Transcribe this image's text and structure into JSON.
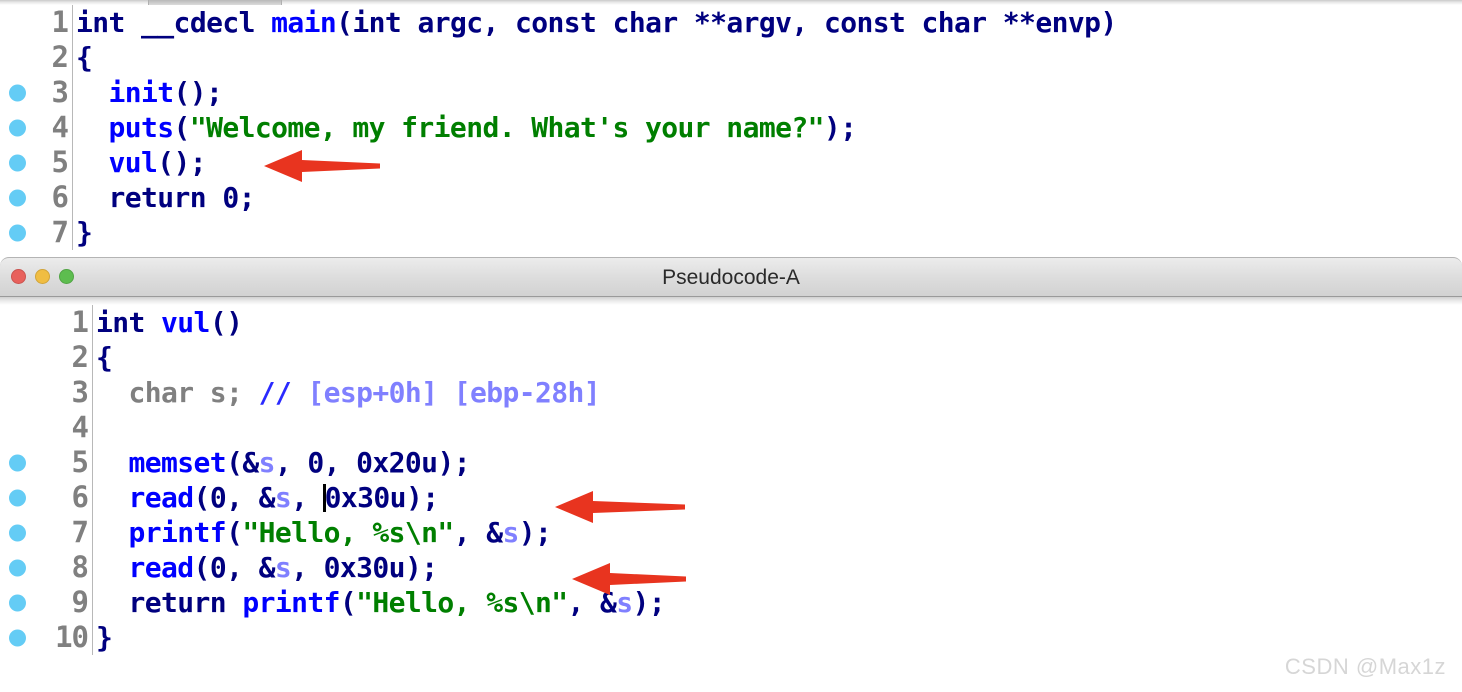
{
  "app": {
    "watermark": "CSDN @Max1z"
  },
  "colors": {
    "keyword": "#00007f",
    "function": "#0000ff",
    "string": "#007f00",
    "local_var": "#8080ff",
    "comment": "#8080ff",
    "declaration_type": "#808080",
    "breakpoint_dot": "#64ccf5",
    "line_number": "#808080",
    "arrow": "#e8341f",
    "traffic_red": "#e8615c",
    "traffic_yellow": "#f0bd42",
    "traffic_green": "#5dbd4f"
  },
  "pane_main": {
    "title": "",
    "lines": [
      {
        "num": "1",
        "breakpoint": false,
        "text": "int __cdecl main(int argc, const char **argv, const char **envp)"
      },
      {
        "num": "2",
        "breakpoint": false,
        "text": "{"
      },
      {
        "num": "3",
        "breakpoint": true,
        "text": "  init();"
      },
      {
        "num": "4",
        "breakpoint": true,
        "text": "  puts(\"Welcome, my friend. What's your name?\");"
      },
      {
        "num": "5",
        "breakpoint": true,
        "text": "  vul();"
      },
      {
        "num": "6",
        "breakpoint": true,
        "text": "  return 0;"
      },
      {
        "num": "7",
        "breakpoint": true,
        "text": "}"
      }
    ]
  },
  "pane_vul": {
    "title": "Pseudocode-A",
    "window_buttons": [
      "close",
      "minimize",
      "zoom"
    ],
    "lines": [
      {
        "num": "1",
        "breakpoint": false,
        "text": "int vul()"
      },
      {
        "num": "2",
        "breakpoint": false,
        "text": "{"
      },
      {
        "num": "3",
        "breakpoint": false,
        "text": "  char s; // [esp+0h] [ebp-28h]"
      },
      {
        "num": "4",
        "breakpoint": false,
        "text": ""
      },
      {
        "num": "5",
        "breakpoint": true,
        "text": "  memset(&s, 0, 0x20u);"
      },
      {
        "num": "6",
        "breakpoint": true,
        "text": "  read(0, &s, 0x30u);"
      },
      {
        "num": "7",
        "breakpoint": true,
        "text": "  printf(\"Hello, %s\\n\", &s);"
      },
      {
        "num": "8",
        "breakpoint": true,
        "text": "  read(0, &s, 0x30u);"
      },
      {
        "num": "9",
        "breakpoint": true,
        "text": "  return printf(\"Hello, %s\\n\", &s);"
      },
      {
        "num": "10",
        "breakpoint": true,
        "text": "}"
      }
    ],
    "caret_line": "6",
    "caret_before": "0x30u"
  },
  "annotations": [
    {
      "id": "arrow-vul-call",
      "points_to_line": "5",
      "pane": "pane_main",
      "direction": "left"
    },
    {
      "id": "arrow-read-1",
      "points_to_line": "6",
      "pane": "pane_vul",
      "direction": "left"
    },
    {
      "id": "arrow-read-2",
      "points_to_line": "8",
      "pane": "pane_vul",
      "direction": "left"
    }
  ]
}
